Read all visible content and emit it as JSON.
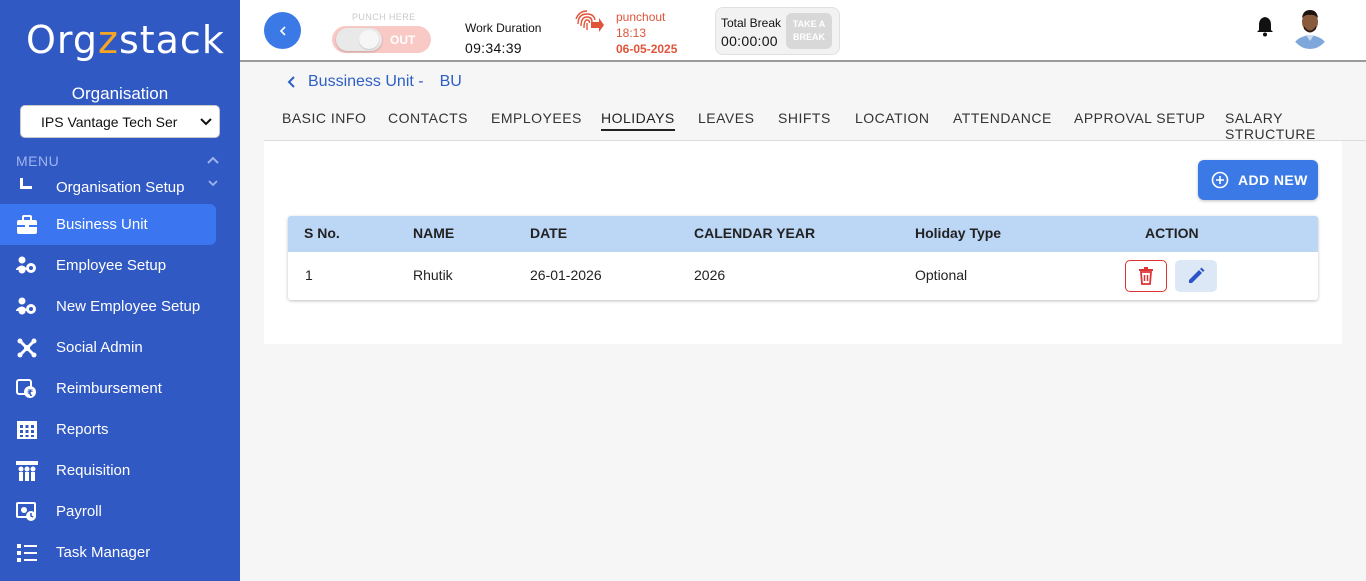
{
  "sidebar": {
    "logo": {
      "part1": "Org",
      "part2": "z",
      "part3": "stack"
    },
    "organisation_label": "Organisation",
    "organisation_select": "IPS Vantage Tech Ser",
    "menu_label": "MENU",
    "items": [
      {
        "label": "Organisation Setup",
        "icon": "org-setup-icon"
      },
      {
        "label": "Business Unit",
        "icon": "briefcase-icon",
        "active": true
      },
      {
        "label": "Employee Setup",
        "icon": "employee-gear-icon"
      },
      {
        "label": "New Employee Setup",
        "icon": "employee-gear-icon"
      },
      {
        "label": "Social Admin",
        "icon": "social-icon"
      },
      {
        "label": "Reimbursement",
        "icon": "reimbursement-icon"
      },
      {
        "label": "Reports",
        "icon": "reports-icon"
      },
      {
        "label": "Requisition",
        "icon": "requisition-icon"
      },
      {
        "label": "Payroll",
        "icon": "payroll-icon"
      },
      {
        "label": "Task Manager",
        "icon": "task-list-icon"
      }
    ]
  },
  "topbar": {
    "punch_here": "PUNCH HERE",
    "punch_state": "OUT",
    "work_duration_label": "Work Duration",
    "work_duration_value": "09:34:39",
    "punchout_label": "punchout",
    "punchout_time": "18:13",
    "punchout_date": "06-05-2025",
    "total_break_label": "Total Break",
    "total_break_value": "00:00:00",
    "take_break_line1": "TAKE A",
    "take_break_line2": "BREAK"
  },
  "breadcrumb": {
    "title": "Bussiness Unit -",
    "code": "BU"
  },
  "tabs": [
    "BASIC INFO",
    "CONTACTS",
    "EMPLOYEES",
    "HOLIDAYS",
    "LEAVES",
    "SHIFTS",
    "LOCATION",
    "ATTENDANCE",
    "APPROVAL SETUP",
    "SALARY STRUCTURE"
  ],
  "active_tab": "HOLIDAYS",
  "add_button": "ADD NEW",
  "table": {
    "columns": [
      "S No.",
      "NAME",
      "DATE",
      "CALENDAR YEAR",
      "Holiday Type",
      "ACTION"
    ],
    "rows": [
      [
        "1",
        "Rhutik",
        "26-01-2026",
        "2026",
        "Optional"
      ]
    ]
  },
  "colors": {
    "sidebar": "#3159c4",
    "accent": "#3b7ae6",
    "table_header": "#bcd6f6",
    "punchout": "#e2543a",
    "delete": "#d33333"
  }
}
